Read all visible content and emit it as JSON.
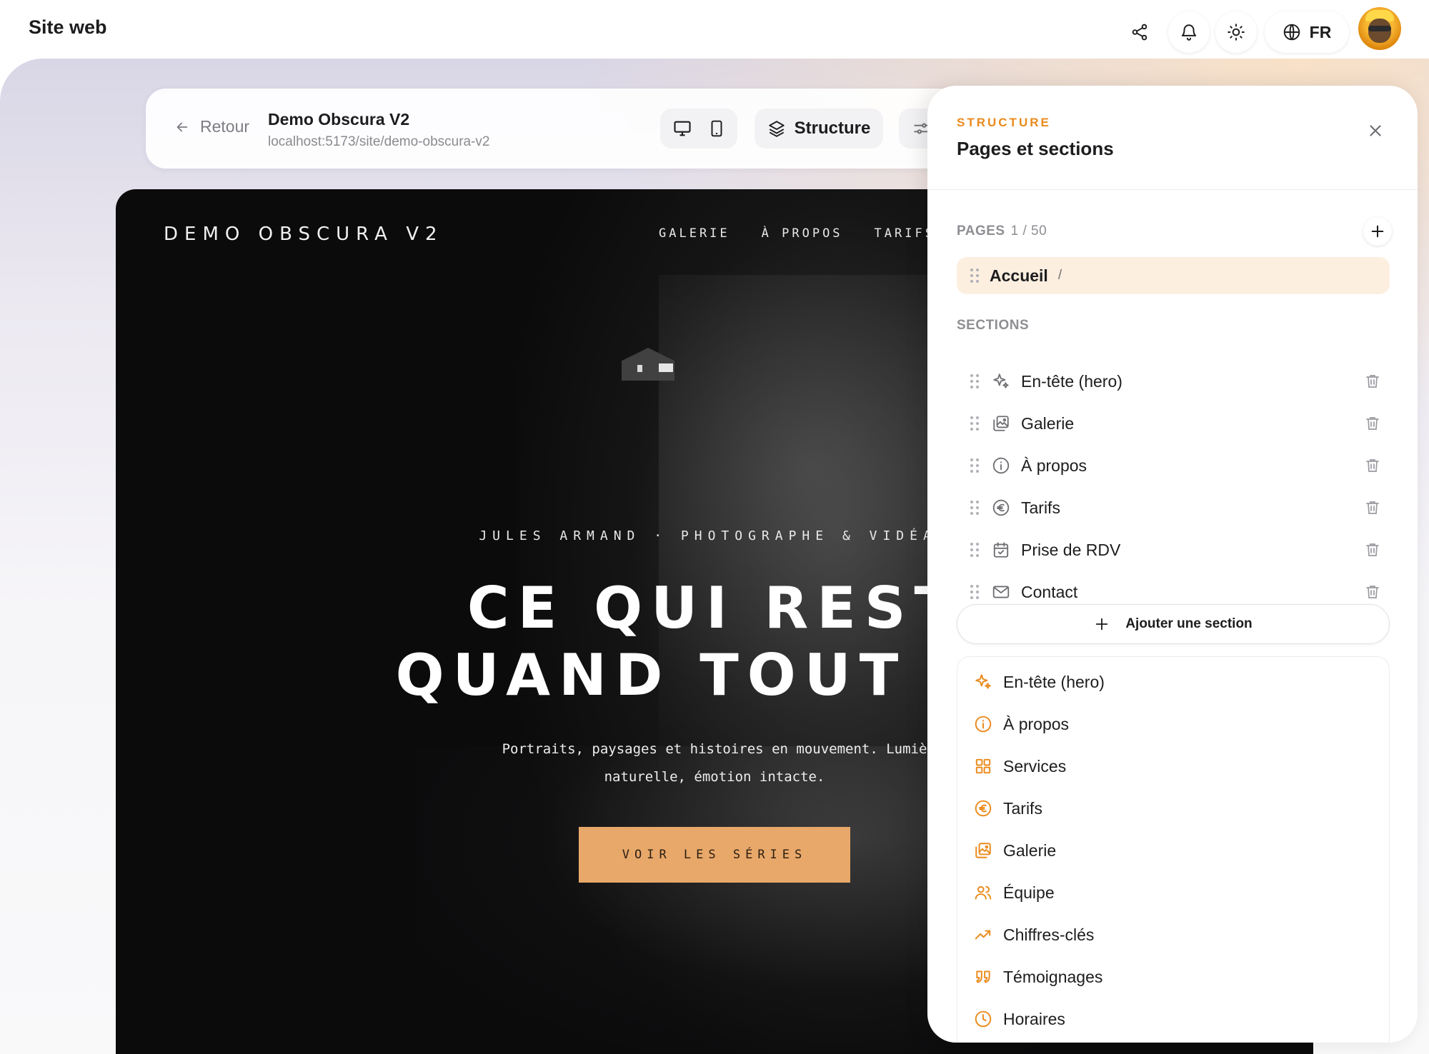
{
  "app": {
    "title": "Site web"
  },
  "topbar": {
    "lang": "FR",
    "icons": [
      "share-icon",
      "bell-icon",
      "sun-icon",
      "globe-icon"
    ]
  },
  "toolbar": {
    "back_label": "Retour",
    "site_name": "Demo Obscura V2",
    "site_url": "localhost:5173/site/demo-obscura-v2",
    "structure_label": "Structure"
  },
  "preview": {
    "brand": "DEMO OBSCURA V2",
    "nav": [
      "GALERIE",
      "À PROPOS",
      "TARIFS"
    ],
    "kicker": "JULES ARMAND · PHOTOGRAPHE & VIDÉAS",
    "headline_line1": "CE QUI REST",
    "headline_line2": "QUAND TOUT PA",
    "subtext_line1": "Portraits, paysages et histoires en mouvement. Lumiè",
    "subtext_line2": "naturelle, émotion intacte.",
    "cta": "VOIR LES SÉRIES",
    "cta_color": "#e8a86a"
  },
  "panel": {
    "kicker": "STRUCTURE",
    "title": "Pages et sections",
    "pages_label": "PAGES",
    "pages_count": "1 / 50",
    "page": {
      "name": "Accueil",
      "path": "/"
    },
    "sections_label": "SECTIONS",
    "sections": [
      {
        "label": "En-tête (hero)",
        "icon": "sparkles-icon"
      },
      {
        "label": "Galerie",
        "icon": "gallery-icon"
      },
      {
        "label": "À propos",
        "icon": "info-icon"
      },
      {
        "label": "Tarifs",
        "icon": "euro-icon"
      },
      {
        "label": "Prise de RDV",
        "icon": "calendar-icon"
      },
      {
        "label": "Contact",
        "icon": "mail-icon"
      }
    ],
    "add_section_label": "Ajouter une section",
    "catalog": [
      {
        "label": "En-tête (hero)",
        "icon": "sparkles-icon"
      },
      {
        "label": "À propos",
        "icon": "info-icon"
      },
      {
        "label": "Services",
        "icon": "grid-icon"
      },
      {
        "label": "Tarifs",
        "icon": "euro-icon"
      },
      {
        "label": "Galerie",
        "icon": "gallery-icon"
      },
      {
        "label": "Équipe",
        "icon": "users-icon"
      },
      {
        "label": "Chiffres-clés",
        "icon": "trending-up-icon"
      },
      {
        "label": "Témoignages",
        "icon": "quote-icon"
      },
      {
        "label": "Horaires",
        "icon": "clock-icon"
      }
    ],
    "accent_color": "#ea8a1c"
  }
}
